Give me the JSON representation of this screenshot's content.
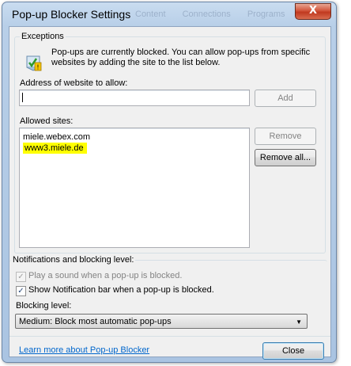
{
  "window": {
    "title": "Pop-up Blocker Settings",
    "close_glyph": "X",
    "background_tabs": [
      "Content",
      "Connections",
      "Programs"
    ]
  },
  "exceptions": {
    "legend": "Exceptions",
    "info_icon": "shield-warning-icon",
    "info_text": "Pop-ups are currently blocked.  You can allow pop-ups from specific websites by adding the site to the list below.",
    "address_label": "Address of website to allow:",
    "address_value": "",
    "add_label": "Add",
    "allowed_label": "Allowed sites:",
    "allowed_sites": [
      "miele.webex.com",
      "www3.miele.de"
    ],
    "remove_label": "Remove",
    "remove_all_label": "Remove all..."
  },
  "notifications": {
    "legend": "Notifications and blocking level:",
    "play_sound_label": "Play a sound when a pop-up is blocked.",
    "play_sound_checked": true,
    "show_bar_label": "Show Notification bar when a pop-up is blocked.",
    "show_bar_checked": true,
    "blocking_level_label": "Blocking level:",
    "blocking_level_value": "Medium: Block most automatic pop-ups"
  },
  "footer": {
    "learn_more": "Learn more about Pop-up Blocker",
    "close_label": "Close"
  },
  "colors": {
    "highlight": "#ffff00",
    "link": "#0066cc",
    "close_button": "#c0391f"
  }
}
